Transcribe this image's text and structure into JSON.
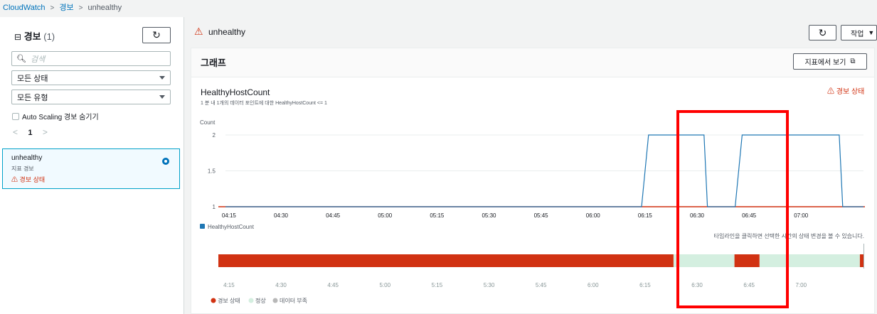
{
  "breadcrumb": {
    "items": [
      "CloudWatch",
      "경보",
      "unhealthy"
    ]
  },
  "sidebar": {
    "title": "경보",
    "count": "(1)",
    "search_placeholder": "검색",
    "state_filter": "모든 상태",
    "type_filter": "모든 유형",
    "hide_autoscaling_label": "Auto Scaling 경보 숨기기",
    "page_number": "1",
    "alarm": {
      "name": "unhealthy",
      "type": "지표 경보",
      "state": "경보 상태"
    }
  },
  "detail": {
    "alarm_name": "unhealthy",
    "actions_label": "작업"
  },
  "graph_panel": {
    "title": "그래프",
    "view_in_metrics_label": "지표에서 보기",
    "metric_title": "HealthyHostCount",
    "condition_text": "1 분 내 1개의 데이터 포인트에 대한 HealthyHostCount <= 1",
    "state_label": "경보 상태",
    "timeline_hint": "타임라인을 클릭하면 선택한 시간의 상태 변경을 볼 수 있습니다.",
    "timeline_legend": [
      "경보 상태",
      "정상",
      "데이터 부족"
    ],
    "timeline_ticks": [
      "4:15",
      "4:30",
      "4:45",
      "5:00",
      "5:15",
      "5:30",
      "5:45",
      "6:00",
      "6:15",
      "6:30",
      "6:45",
      "7:00"
    ]
  },
  "colors": {
    "alarm": "#d13212",
    "ok": "#d4efe0",
    "insufficient": "#b8b8b8",
    "series": "#1f77b4",
    "link": "#0073bb",
    "highlight": "#ff0000"
  },
  "chart_data": {
    "type": "line",
    "title": "HealthyHostCount",
    "ylabel": "Count",
    "x_ticks": [
      "04:15",
      "04:30",
      "04:45",
      "05:00",
      "05:15",
      "05:30",
      "05:45",
      "06:00",
      "06:15",
      "06:30",
      "06:45",
      "07:00"
    ],
    "ylim": [
      1,
      2
    ],
    "y_ticks": [
      1,
      1.5,
      2
    ],
    "threshold": 1,
    "series": [
      {
        "name": "HealthyHostCount",
        "points": [
          [
            "04:14",
            1
          ],
          [
            "06:14",
            1
          ],
          [
            "06:16",
            2
          ],
          [
            "06:32",
            2
          ],
          [
            "06:33",
            1
          ],
          [
            "06:41",
            1
          ],
          [
            "06:43",
            2
          ],
          [
            "07:11",
            2
          ],
          [
            "07:12",
            1
          ],
          [
            "07:18",
            1
          ]
        ]
      }
    ],
    "timeline": [
      {
        "start": "04:14",
        "end": "06:21",
        "state": "alarm"
      },
      {
        "start": "06:21",
        "end": "06:38",
        "state": "ok"
      },
      {
        "start": "06:38",
        "end": "06:45",
        "state": "alarm"
      },
      {
        "start": "06:45",
        "end": "07:13",
        "state": "ok"
      },
      {
        "start": "07:13",
        "end": "07:14",
        "state": "alarm"
      }
    ]
  }
}
